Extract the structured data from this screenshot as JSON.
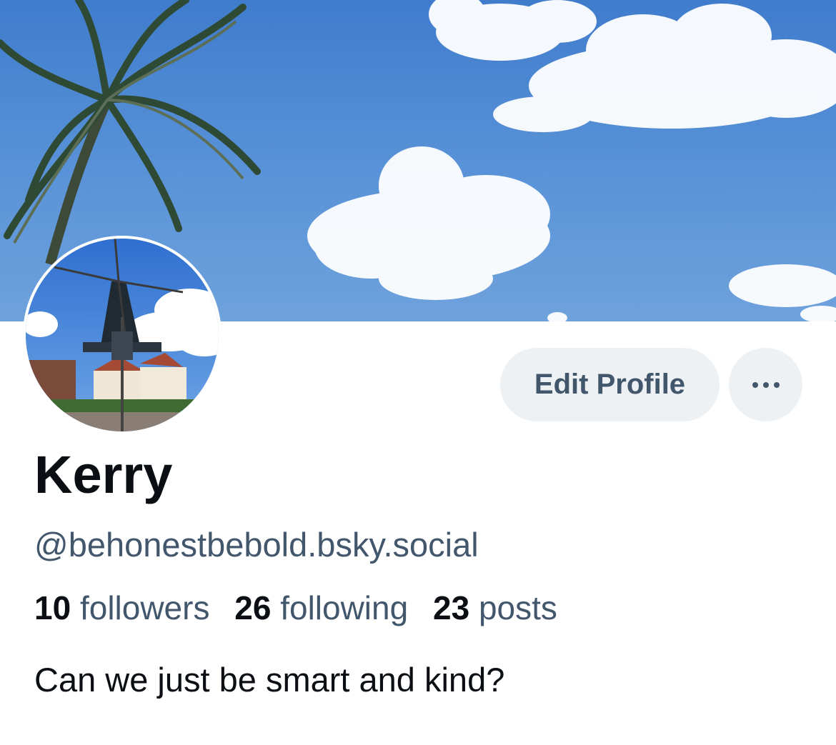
{
  "profile": {
    "display_name": "Kerry",
    "handle": "@behonestbebold.bsky.social",
    "bio": "Can we just be smart and kind?"
  },
  "stats": {
    "followers_count": "10",
    "followers_label": "followers",
    "following_count": "26",
    "following_label": "following",
    "posts_count": "23",
    "posts_label": "posts"
  },
  "actions": {
    "edit_profile_label": "Edit Profile",
    "more_icon": "ellipsis-icon"
  },
  "banner": {
    "description_icon": "sky-palm-banner"
  },
  "colors": {
    "primary_text": "#0b0f14",
    "secondary_text": "#42566c",
    "button_bg": "#eef1f4",
    "sky": "#4f8ad4"
  }
}
